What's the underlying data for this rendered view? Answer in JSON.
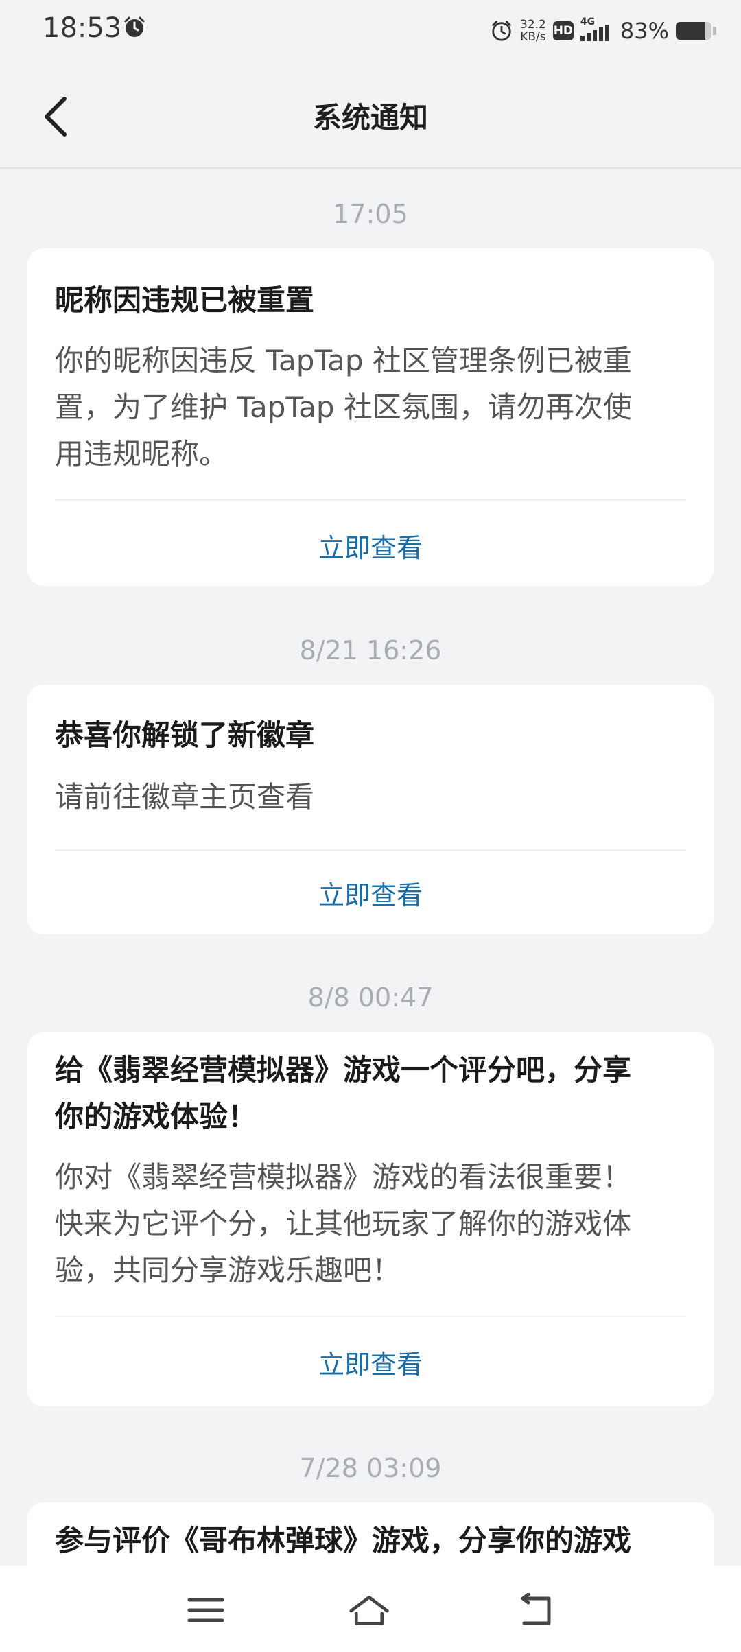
{
  "status_bar": {
    "time": "18:53",
    "net_speed_value": "32.2",
    "net_speed_unit": "KB/s",
    "hd_label": "HD",
    "network_label": "4G",
    "battery_percent_text": "83%",
    "battery_level": 0.83,
    "icons": [
      "alarm-icon",
      "alarm-icon",
      "hd-icon",
      "signal-icon",
      "battery-icon"
    ]
  },
  "header": {
    "title": "系统通知",
    "back_icon": "chevron-left-icon"
  },
  "notifications": [
    {
      "time": "17:05",
      "title": "昵称因违规已被重置",
      "body_lines": [
        "你的昵称因违反 TapTap 社区管理条例已被重",
        "置，为了维护 TapTap 社区氛围，请勿再次使",
        "用违规昵称。"
      ],
      "action": "立即查看"
    },
    {
      "time": "8/21  16:26",
      "title": "恭喜你解锁了新徽章",
      "body_lines": [
        "请前往徽章主页查看"
      ],
      "action": "立即查看"
    },
    {
      "time": "8/8  00:47",
      "title_lines": [
        "给《翡翠经营模拟器》游戏一个评分吧，分享",
        "你的游戏体验！"
      ],
      "body_lines": [
        "你对《翡翠经营模拟器》游戏的看法很重要！",
        "快来为它评个分，让其他玩家了解你的游戏体",
        "验，共同分享游戏乐趣吧！"
      ],
      "action": "立即查看"
    },
    {
      "time": "7/28  03:09",
      "title_lines": [
        "参与评价《哥布林弹球》游戏，分享你的游戏"
      ]
    }
  ],
  "nav_bar": {
    "icons": [
      "menu-icon",
      "home-icon",
      "back-icon"
    ]
  },
  "colors": {
    "background": "#f2f3f5",
    "card": "#ffffff",
    "action_link": "#1c6ea4",
    "timestamp": "#a9adb3"
  }
}
